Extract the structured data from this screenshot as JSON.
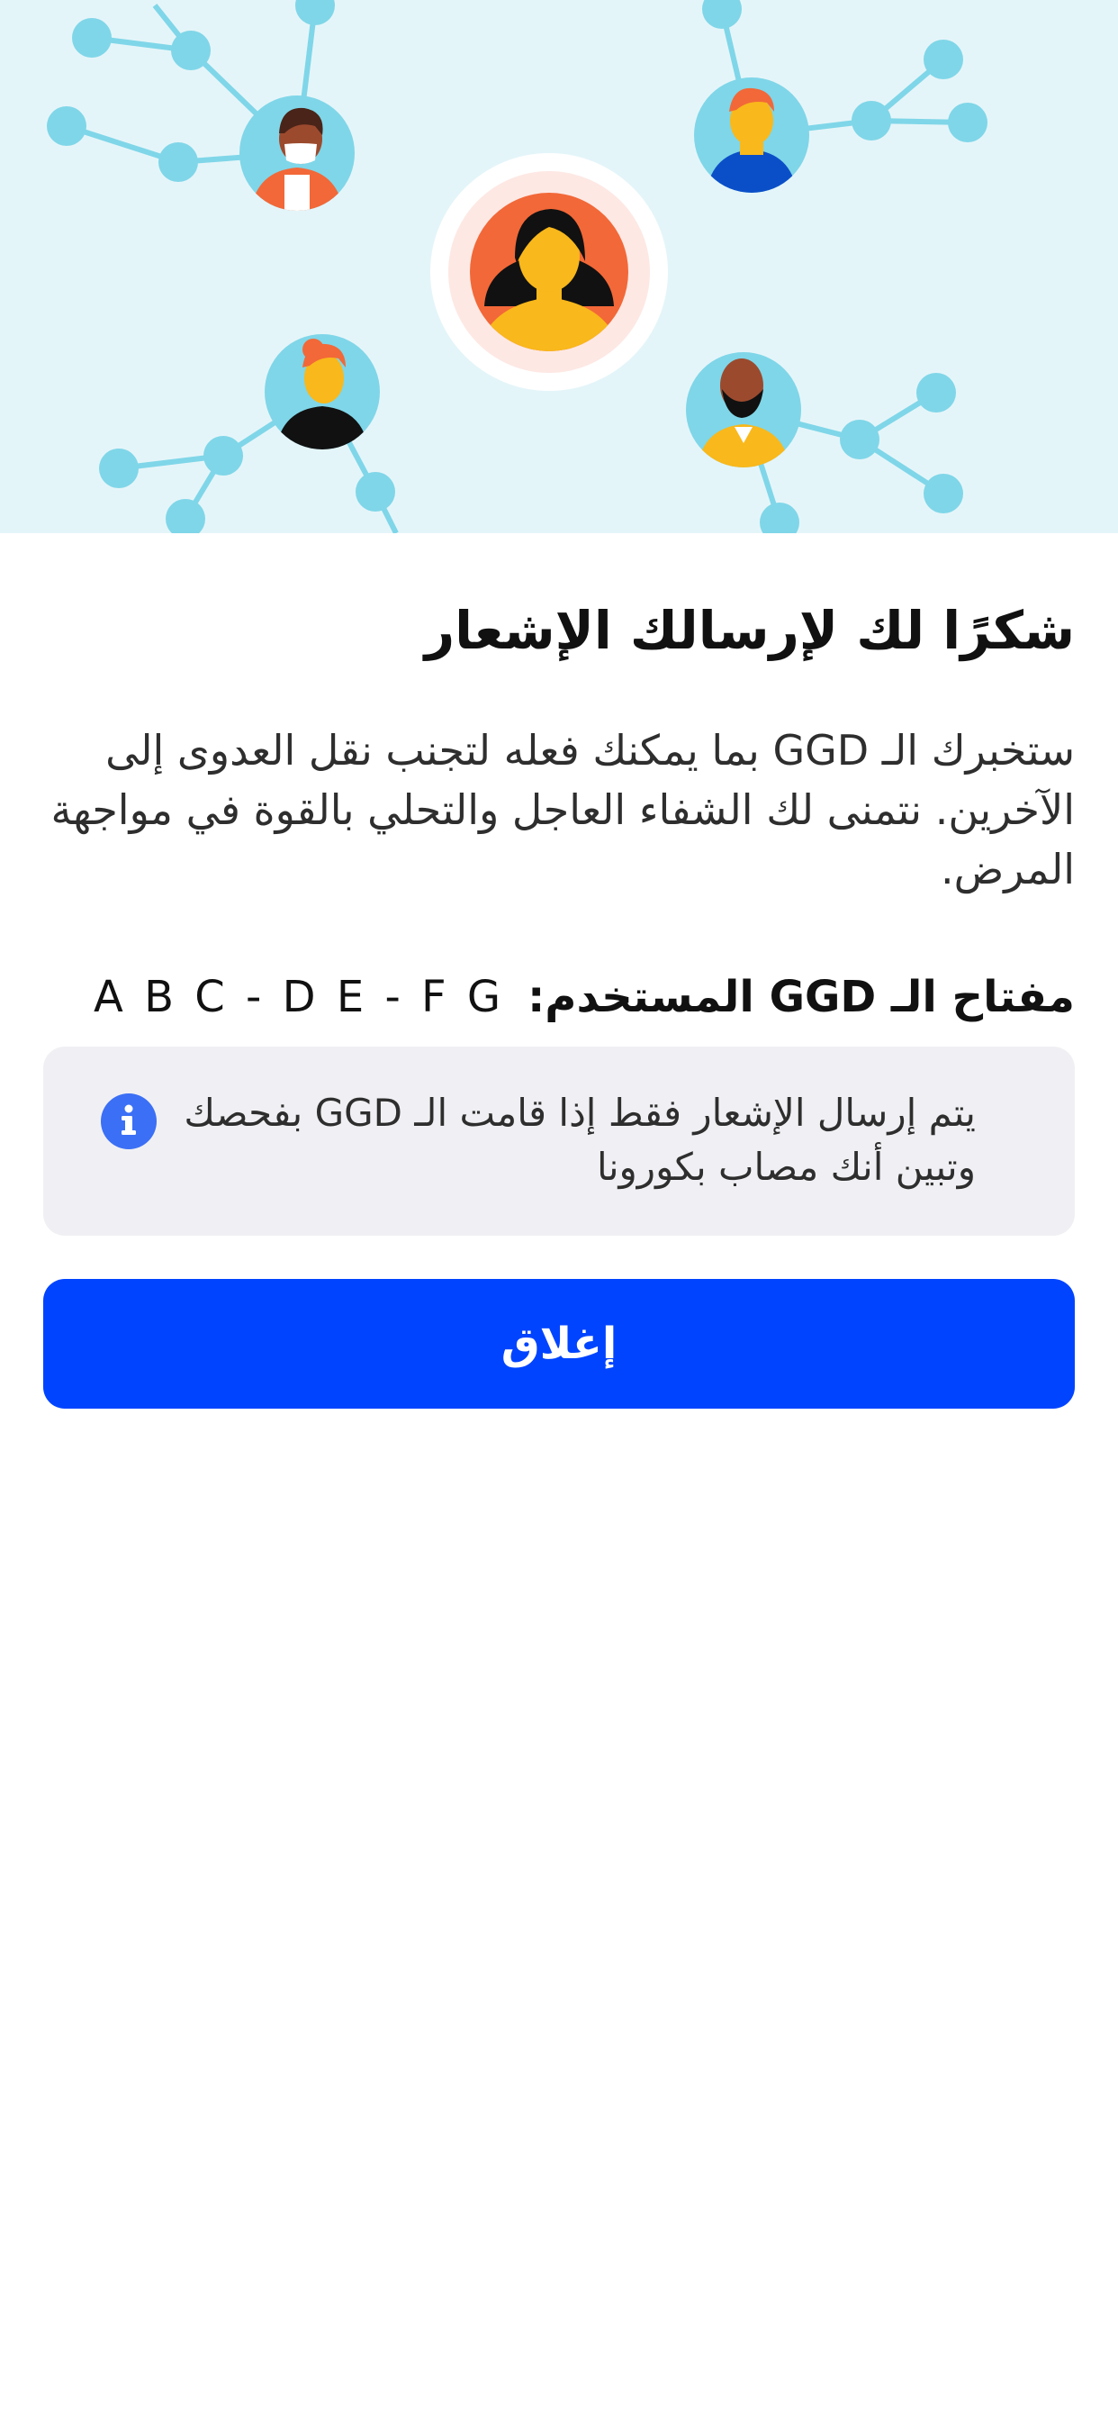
{
  "screen": {
    "title": "شكرًا لك لإرسالك الإشعار",
    "description": "ستخبرك الـ GGD بما يمكنك فعله لتجنب نقل العدوى إلى الآخرين. نتمنى لك الشفاء العاجل والتحلي بالقوة في مواجهة المرض.",
    "key_label": "مفتاح الـ GGD المستخدم:",
    "key_value": "A B C - D E - F G",
    "info_text": "يتم إرسال الإشعار فقط إذا قامت الـ GGD بفحصك وتبين أنك مصاب بكورونا",
    "close_button": "إغلاق"
  },
  "colors": {
    "accent": "#0044ff",
    "hero_background": "#e4f5f9",
    "network_nodes": "#7fd6e8",
    "info_background": "#f0f0f4",
    "info_icon": "#3b6ff5"
  },
  "icons": {
    "info": "info-circle-icon"
  }
}
